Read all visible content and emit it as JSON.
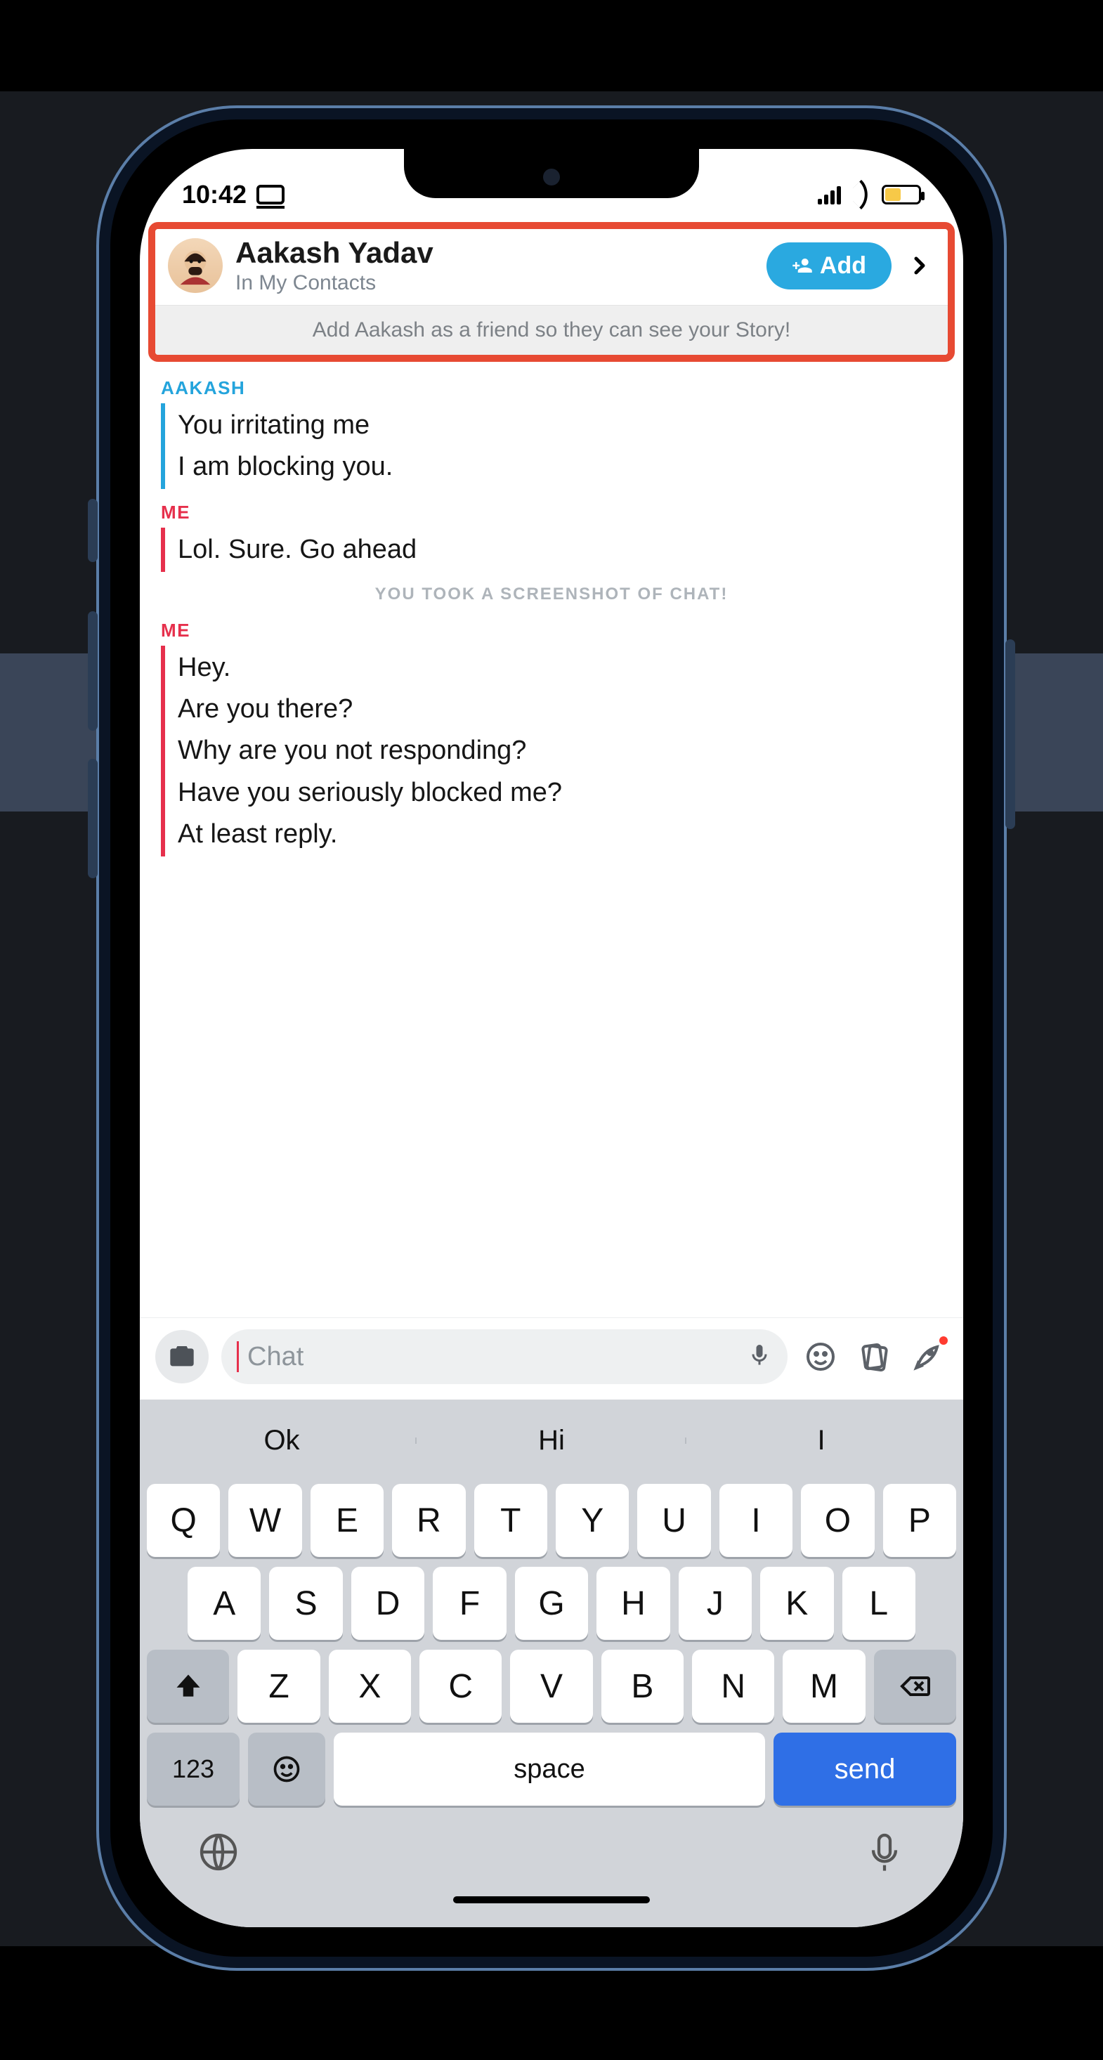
{
  "status": {
    "time": "10:42"
  },
  "header": {
    "name": "Aakash Yadav",
    "subtitle": "In My Contacts",
    "add_label": "Add",
    "banner": "Add Aakash as a friend so they can see your Story!"
  },
  "chat": {
    "other_label": "AAKASH",
    "me_label": "ME",
    "other_msg": [
      "You irritating me",
      "I am blocking you."
    ],
    "me_msg1": [
      "Lol. Sure. Go ahead"
    ],
    "system_note": "YOU TOOK A SCREENSHOT OF CHAT!",
    "me_msg2": [
      "Hey.",
      "Are you there?",
      "Why are you not responding?",
      "Have you seriously blocked me?",
      "At least reply."
    ]
  },
  "input": {
    "placeholder": "Chat"
  },
  "keyboard": {
    "predictions": [
      "Ok",
      "Hi",
      "I"
    ],
    "row1": [
      "Q",
      "W",
      "E",
      "R",
      "T",
      "Y",
      "U",
      "I",
      "O",
      "P"
    ],
    "row2": [
      "A",
      "S",
      "D",
      "F",
      "G",
      "H",
      "J",
      "K",
      "L"
    ],
    "row3": [
      "Z",
      "X",
      "C",
      "V",
      "B",
      "N",
      "M"
    ],
    "numkey": "123",
    "space": "space",
    "send": "send"
  }
}
